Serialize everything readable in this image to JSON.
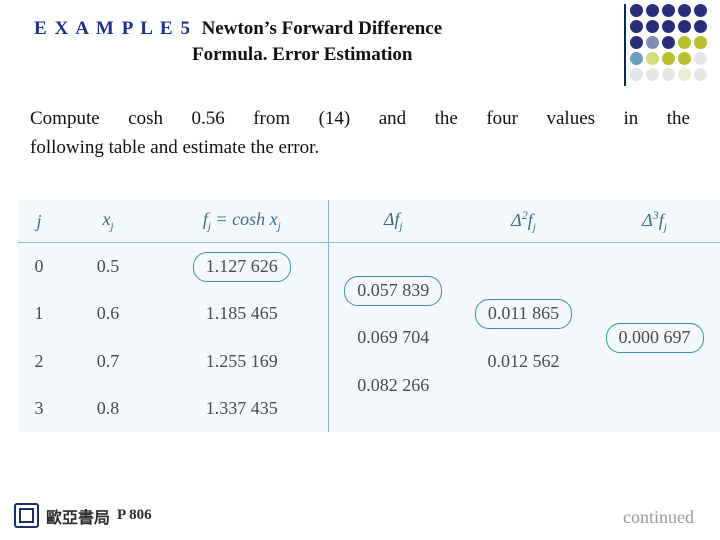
{
  "header": {
    "example_label": "E X A M P L E 5",
    "title_line1": "Newton’s Forward Difference",
    "title_line2": "Formula. Error Estimation"
  },
  "body": {
    "paragraph_line1": "Compute cosh 0.56 from (14) and the four values in the",
    "paragraph_line2": "following table and estimate the error."
  },
  "table": {
    "headers": {
      "j": "j",
      "xj": "xⱼ",
      "fj": "fⱼ = cosh xⱼ",
      "d1": "Δfⱼ",
      "d2": "Δ²fⱼ",
      "d3": "Δ³fⱼ"
    },
    "rows": [
      {
        "j": "0",
        "x": "0.5",
        "f": "1.127 626",
        "f_circled": true
      },
      {
        "j": "1",
        "x": "0.6",
        "f": "1.185 465",
        "f_circled": false
      },
      {
        "j": "2",
        "x": "0.7",
        "f": "1.255 169",
        "f_circled": false
      },
      {
        "j": "3",
        "x": "0.8",
        "f": "1.337 435",
        "f_circled": false
      }
    ],
    "first_differences": [
      {
        "value": "0.057 839",
        "circled": true
      },
      {
        "value": "0.069 704",
        "circled": false
      },
      {
        "value": "0.082 266",
        "circled": false
      }
    ],
    "second_differences": [
      {
        "value": "0.011 865",
        "circled": true
      },
      {
        "value": "0.012 562",
        "circled": false
      }
    ],
    "third_differences": [
      {
        "value": "0.000 697",
        "circled": true
      }
    ]
  },
  "footer": {
    "publisher": "歐亞書局",
    "page": "P 806",
    "continued": "continued"
  },
  "decor": {
    "dot_colors": [
      "#2b2f77",
      "#2b2f77",
      "#2b2f77",
      "#2b2f77",
      "#2b2f77",
      "#2b2f77",
      "#2b2f77",
      "#2b2f77",
      "#2b2f77",
      "#2b2f77",
      "#2b2f77",
      "#7f8fae",
      "#2b2f77",
      "#b9bf2e",
      "#b9bf2e",
      "#6f9fb5",
      "#d9dc7a",
      "#b9bf2e",
      "#b9bf2e",
      "#e6e6e6",
      "#dfe3ea",
      "#e6e6e6",
      "#e6e6e6",
      "#e9ebd6",
      "#e6e6e6"
    ],
    "rule_color": "#0a2a5e"
  }
}
